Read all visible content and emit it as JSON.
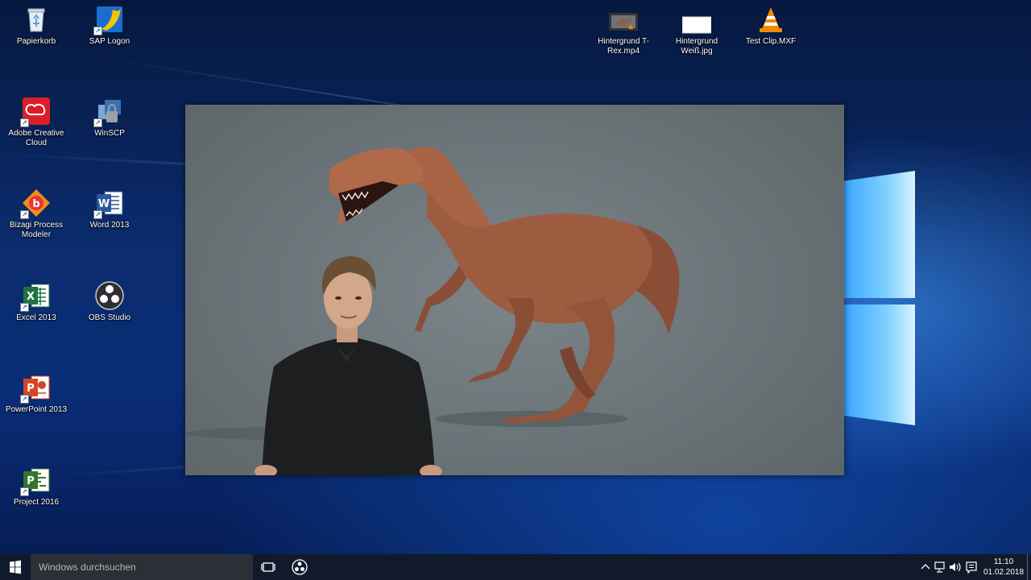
{
  "desktop": {
    "icons_left": [
      {
        "label": "Papierkorb",
        "icon": "recycle-bin-icon"
      },
      {
        "label": "SAP Logon",
        "icon": "sap-logon-icon"
      },
      {
        "label": "Adobe Creative Cloud",
        "icon": "adobe-cc-icon"
      },
      {
        "label": "WinSCP",
        "icon": "winscp-icon"
      },
      {
        "label": "Bizagi Process Modeler",
        "icon": "bizagi-icon"
      },
      {
        "label": "Word 2013",
        "icon": "word-icon"
      },
      {
        "label": "Excel 2013",
        "icon": "excel-icon"
      },
      {
        "label": "OBS Studio",
        "icon": "obs-icon"
      },
      {
        "label": "PowerPoint 2013",
        "icon": "powerpoint-icon"
      },
      {
        "label": "Project 2016",
        "icon": "project-icon"
      }
    ],
    "icons_top": [
      {
        "label": "Hintergrund T-Rex.mp4",
        "icon": "video-file-icon"
      },
      {
        "label": "Hintergrund Weiß.jpg",
        "icon": "image-file-icon"
      },
      {
        "label": "Test Clip.MXF",
        "icon": "vlc-icon"
      }
    ]
  },
  "colors": {
    "taskbar": "#101a2a",
    "search_box": "#2b2f36",
    "wallpaper_accent": "#3aa7ff",
    "excel": "#1f7244",
    "word": "#2b579a",
    "powerpoint": "#d24726",
    "project": "#31752f",
    "adobe": "#da1f26"
  },
  "taskbar": {
    "search_placeholder": "Windows durchsuchen",
    "time": "11:10",
    "date": "01.02.2018"
  }
}
